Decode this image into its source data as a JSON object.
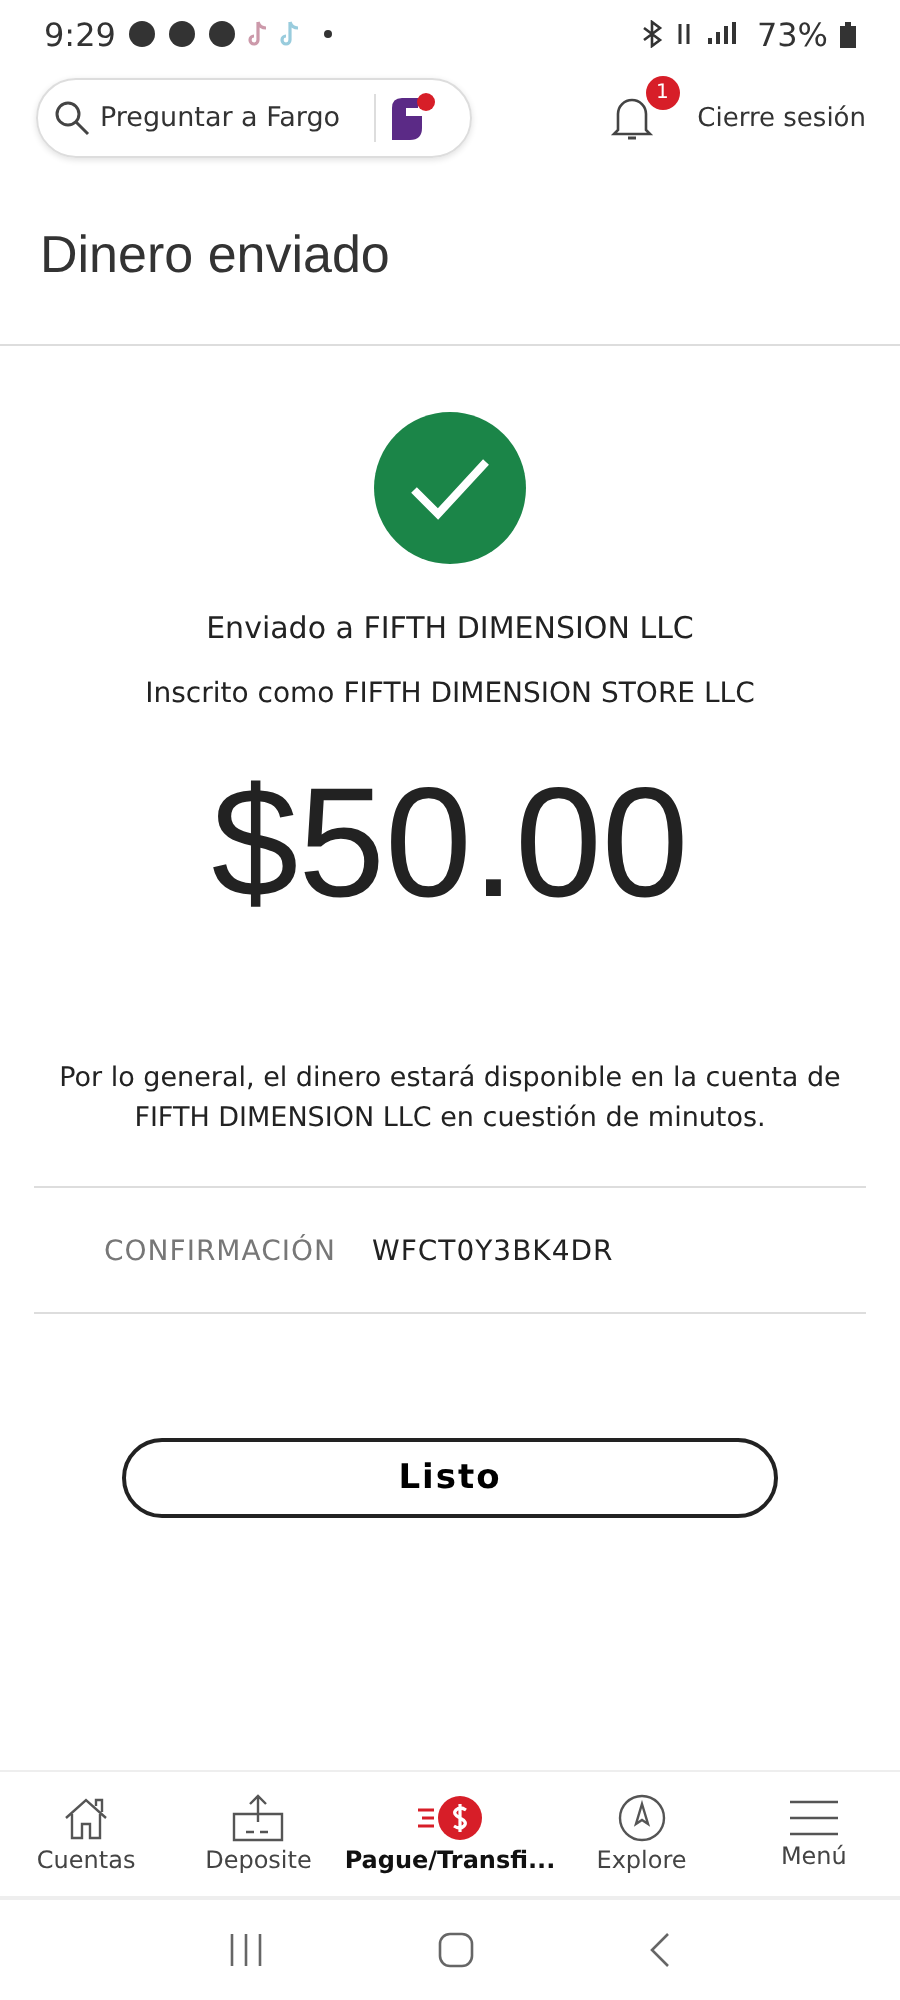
{
  "status_bar": {
    "time": "9:29",
    "battery": "73%"
  },
  "header": {
    "search": {
      "placeholder": "Preguntar a Fargo"
    },
    "notifications": {
      "count": "1"
    },
    "logout": "Cierre sesión"
  },
  "title": "Dinero enviado",
  "result": {
    "sent_to": "Enviado a FIFTH DIMENSION LLC",
    "enrolled_as": "Inscrito como FIFTH DIMENSION STORE LLC",
    "amount": "$50.00",
    "note": "Por lo general, el dinero estará disponible en la cuenta de FIFTH DIMENSION LLC en cuestión de minutos."
  },
  "confirmation": {
    "label": "CONFIRMACIÓN",
    "value": "WFCT0Y3BK4DR"
  },
  "done_button": "Listo",
  "bottom_nav": [
    {
      "kind": "home",
      "label": "Cuentas",
      "selected": false
    },
    {
      "kind": "deposit",
      "label": "Deposite",
      "selected": false
    },
    {
      "kind": "pay",
      "label": "Pague/Transfi...",
      "selected": true
    },
    {
      "kind": "explore",
      "label": "Explore",
      "selected": false
    },
    {
      "kind": "menu",
      "label": "Menú",
      "selected": false
    }
  ]
}
